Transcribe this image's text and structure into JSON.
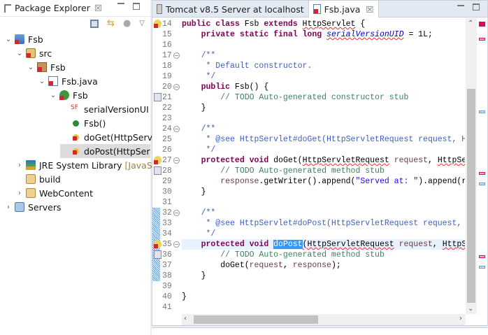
{
  "package_explorer": {
    "title": "Package Explorer",
    "tree": [
      {
        "label": "Fsb",
        "depth": 0,
        "twisty": "v",
        "icon": "project-icon",
        "err": true
      },
      {
        "label": "src",
        "depth": 1,
        "twisty": "v",
        "icon": "source-folder-icon",
        "err": true
      },
      {
        "label": "Fsb",
        "depth": 2,
        "twisty": "v",
        "icon": "package-icon",
        "err": true
      },
      {
        "label": "Fsb.java",
        "depth": 3,
        "twisty": "v",
        "icon": "java-file-icon",
        "err": true
      },
      {
        "label": "Fsb",
        "depth": 4,
        "twisty": "v",
        "icon": "class-icon",
        "err": true
      },
      {
        "label": "serialVersionUI",
        "depth": 5,
        "twisty": "",
        "icon": "static-final-field-icon",
        "err": false
      },
      {
        "label": "Fsb()",
        "depth": 5,
        "twisty": "",
        "icon": "constructor-icon",
        "err": false
      },
      {
        "label": "doGet(HttpServ",
        "depth": 5,
        "twisty": "",
        "icon": "protected-method-icon",
        "err": true
      },
      {
        "label": "doPost(HttpSer",
        "depth": 5,
        "twisty": "",
        "icon": "protected-method-icon",
        "err": true,
        "selected": true
      },
      {
        "label": "JRE System Library",
        "decoration": "[JavaSE",
        "depth": 1,
        "twisty": ">",
        "icon": "library-icon",
        "err": false
      },
      {
        "label": "build",
        "depth": 1,
        "twisty": "",
        "icon": "folder-icon",
        "err": false
      },
      {
        "label": "WebContent",
        "depth": 1,
        "twisty": ">",
        "icon": "folder-icon",
        "err": false
      },
      {
        "label": "Servers",
        "depth": 0,
        "twisty": ">",
        "icon": "open-folder-icon",
        "err": false
      }
    ]
  },
  "editor": {
    "tabs": [
      {
        "label": "Tomcat v8.5 Server at localhost",
        "active": false
      },
      {
        "label": "Fsb.java",
        "active": true
      }
    ],
    "lines": [
      {
        "n": 14,
        "mark": "error",
        "tokens": [
          [
            "k",
            "public class "
          ],
          [
            "t",
            "Fsb "
          ],
          [
            "k",
            "extends "
          ],
          [
            "t sq",
            "HttpServlet"
          ],
          [
            "t",
            " {"
          ]
        ]
      },
      {
        "n": 15,
        "tokens": [
          [
            "t",
            "    "
          ],
          [
            "k",
            "private static final long "
          ],
          [
            "f sq",
            "serialVersionUID"
          ],
          [
            "t",
            " = 1L;"
          ]
        ]
      },
      {
        "n": 16,
        "tokens": []
      },
      {
        "n": 17,
        "fold": true,
        "tokens": [
          [
            "j",
            "    /**"
          ]
        ]
      },
      {
        "n": 18,
        "tokens": [
          [
            "j",
            "     * Default constructor."
          ]
        ]
      },
      {
        "n": 19,
        "tokens": [
          [
            "j",
            "     */"
          ]
        ]
      },
      {
        "n": 20,
        "fold": true,
        "tokens": [
          [
            "t",
            "    "
          ],
          [
            "k",
            "public "
          ],
          [
            "t",
            "Fsb() {"
          ]
        ]
      },
      {
        "n": 21,
        "mark": "task",
        "tokens": [
          [
            "c",
            "        // TODO Auto-generated constructor stub"
          ]
        ]
      },
      {
        "n": 22,
        "tokens": [
          [
            "t",
            "    }"
          ]
        ]
      },
      {
        "n": 23,
        "tokens": []
      },
      {
        "n": 24,
        "fold": true,
        "tokens": [
          [
            "j",
            "    /**"
          ]
        ]
      },
      {
        "n": 25,
        "tokens": [
          [
            "j",
            "     * @see HttpServlet#doGet(HttpServletRequest request, HttpServletResponse response)"
          ]
        ]
      },
      {
        "n": 26,
        "tokens": [
          [
            "j",
            "     */"
          ]
        ]
      },
      {
        "n": 27,
        "fold": true,
        "mark": "error",
        "tokens": [
          [
            "t",
            "    "
          ],
          [
            "k",
            "protected void "
          ],
          [
            "t",
            "doGet("
          ],
          [
            "t sq",
            "HttpServletRequest"
          ],
          [
            "t",
            " "
          ],
          [
            "p",
            "request"
          ],
          [
            "t",
            ", "
          ],
          [
            "t sq",
            "HttpServletResponse"
          ]
        ]
      },
      {
        "n": 28,
        "mark": "task",
        "tokens": [
          [
            "c",
            "        // TODO Auto-generated method stub"
          ]
        ]
      },
      {
        "n": 29,
        "tokens": [
          [
            "t",
            "        "
          ],
          [
            "p",
            "response"
          ],
          [
            "t",
            ".getWriter().append("
          ],
          [
            "s",
            "\"Served at: \""
          ],
          [
            "t",
            ").append(request.getContextPath());"
          ]
        ]
      },
      {
        "n": 30,
        "tokens": [
          [
            "t",
            "    }"
          ]
        ]
      },
      {
        "n": 31,
        "tokens": []
      },
      {
        "n": 32,
        "fold": true,
        "tokens": [
          [
            "j",
            "    /**"
          ]
        ]
      },
      {
        "n": 33,
        "tokens": [
          [
            "j",
            "     * @see HttpServlet#doPost(HttpServletRequest request, HttpServletResponse response)"
          ]
        ]
      },
      {
        "n": 34,
        "tokens": [
          [
            "j",
            "     */"
          ]
        ]
      },
      {
        "n": 35,
        "fold": true,
        "mark": "error",
        "current": true,
        "tokens": [
          [
            "t",
            "    "
          ],
          [
            "k",
            "protected void "
          ],
          [
            "t sel",
            "doPost"
          ],
          [
            "t sq",
            "(HttpServletRequest"
          ],
          [
            "t",
            " "
          ],
          [
            "p",
            "request"
          ],
          [
            "t",
            ", "
          ],
          [
            "t sq",
            "HttpServletResponse"
          ]
        ]
      },
      {
        "n": 36,
        "mark": "task",
        "tokens": [
          [
            "c",
            "        // TODO Auto-generated method stub"
          ]
        ]
      },
      {
        "n": 37,
        "tokens": [
          [
            "t",
            "        doGet("
          ],
          [
            "p",
            "request"
          ],
          [
            "t",
            ", "
          ],
          [
            "p",
            "response"
          ],
          [
            "t",
            ");"
          ]
        ]
      },
      {
        "n": 38,
        "tokens": [
          [
            "t",
            "    }"
          ]
        ]
      },
      {
        "n": 39,
        "tokens": []
      },
      {
        "n": 40,
        "tokens": [
          [
            "t",
            "}"
          ]
        ]
      },
      {
        "n": 41,
        "tokens": []
      }
    ]
  },
  "colors": {
    "error": "#e8005a",
    "task": "#5aa0e6"
  }
}
